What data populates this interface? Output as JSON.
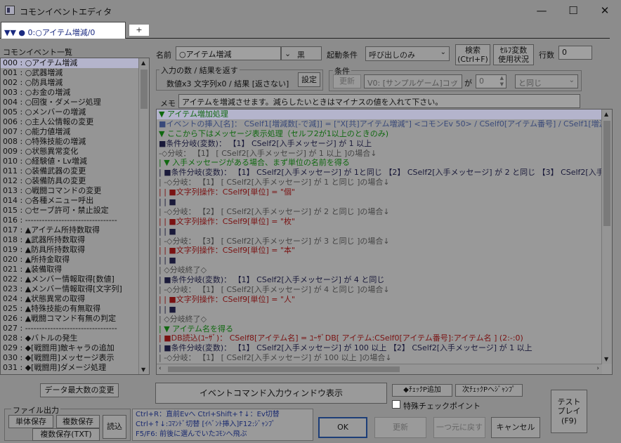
{
  "window": {
    "title": "コモンイベントエディタ",
    "minimize": "—",
    "maximize": "☐",
    "close": "✕"
  },
  "tab": {
    "label": "▼▼ ● 0:○アイテム増減/0",
    "add": "+"
  },
  "list": {
    "header": "コモンイベント一覧",
    "items": [
      "000 : ○アイテム増減",
      "001 : ○武器増減",
      "002 : ○防具増減",
      "003 : ○お金の増減",
      "004 : ○回復・ダメージ処理",
      "005 : ○メンバーの増減",
      "006 : ○主人公情報の変更",
      "007 : ○能力値増減",
      "008 : ○特殊技能の増減",
      "009 : ○状態異常変化",
      "010 : ○経験値・Lv増減",
      "011 : ○装備武器の変更",
      "012 : ○装備防具の変更",
      "013 : ○戦闘コマンドの変更",
      "014 : ○各種メニュー呼出",
      "015 : ○セーブ許可・禁止設定",
      "016 : ---------------------------------",
      "017 : ▲アイテム所持数取得",
      "018 : ▲武器所持数取得",
      "019 : ▲防具所持数取得",
      "020 : ▲所持金取得",
      "021 : ▲装備取得",
      "022 : ▲メンバー情報取得[数値]",
      "023 : ▲メンバー情報取得[文字列]",
      "024 : ▲状態異常の取得",
      "025 : ▲特殊技能の有無取得",
      "026 : ▲戦闘コマンド有無の判定",
      "027 : ---------------------------------",
      "028 : ◆バトルの発生",
      "029 : ◆[戦闘用]敵キャラの追加",
      "030 : ◆[戦闘用]メッセージ表示",
      "031 : ◆[戦闘用]ダメージ処理"
    ]
  },
  "buttons_left": {
    "data_max": "データ最大数の変更",
    "file_output": "ファイル出力",
    "single_save": "単体保存",
    "multi_save": "複数保存",
    "load": "読込",
    "multi_save_txt": "複数保存(TXT)"
  },
  "form": {
    "name_label": "名前",
    "name_value": "○アイテム増減",
    "color_value": "黒",
    "trigger_label": "起動条件",
    "trigger_value": "呼び出しのみ",
    "search_btn": "検索\n(Ctrl+F)",
    "self_var_btn": "ｾﾙﾌ変数\n使用状況",
    "lines_label": "行数",
    "lines_value": "0",
    "io_group": "入力の数 / 結果を返す",
    "io_text": "数値x3 文字列x0 / 結果 [返さない]",
    "io_btn": "設定",
    "cond_group": "条件",
    "cond_update": "更新",
    "cond_var": "V0: [サンプルゲーム]コッ",
    "cond_ga": "が",
    "cond_num": "0",
    "cond_op": "と同じ",
    "memo_label": "メモ",
    "memo_value": "アイテムを増減させます。減らしたいときはマイナスの値を入れて下さい。"
  },
  "commands": [
    {
      "t": "▼ アイテム増加処理",
      "c": "c-green",
      "sel": true
    },
    {
      "t": "■イベントの挿入[名]： CSelf1[増減数[-で減]] = [\"X[共]アイテム増減\"] <コモンEv 50>  / CSelf0[アイテム番号] / CSelf1[増減数[-",
      "c": "c-grayblue"
    },
    {
      "t": "▼ ここから下はメッセージ表示処理（セルフ2が1以上のときのみ)",
      "c": "c-green"
    },
    {
      "t": "■条件分岐(変数)： 【1】 CSelf2[入手メッセージ]  が   1 以上",
      "c": "c-dk"
    },
    {
      "t": "-◇分岐： 【1】 [ CSelf2[入手メッセージ]  が  1 以上  ]の場合↓",
      "c": "c-gray"
    },
    {
      "t": "| ▼ 入手メッセージがある場合、まず単位の名前を得る",
      "c": "c-green"
    },
    {
      "t": "| ■条件分岐(変数)： 【1】 CSelf2[入手メッセージ]  が   1と同じ 【2】 CSelf2[入手メッセージ]  が   2 と同じ 【3】 CSelf2[入手メッセー",
      "c": "c-dk"
    },
    {
      "t": "| -◇分岐： 【1】 [ CSelf2[入手メッセージ]  が  1 と同じ  ]の場合↓",
      "c": "c-gray"
    },
    {
      "t": "| | ■文字列操作：CSelf9[単位] = \"個\"",
      "c": "c-red"
    },
    {
      "t": "| | ■",
      "c": "c-dk"
    },
    {
      "t": "| -◇分岐： 【2】 [ CSelf2[入手メッセージ]  が  2 と同じ  ]の場合↓",
      "c": "c-gray"
    },
    {
      "t": "| | ■文字列操作：CSelf9[単位] = \"枚\"",
      "c": "c-red"
    },
    {
      "t": "| | ■",
      "c": "c-dk"
    },
    {
      "t": "| -◇分岐： 【3】 [ CSelf2[入手メッセージ]  が  3 と同じ  ]の場合↓",
      "c": "c-gray"
    },
    {
      "t": "| | ■文字列操作：CSelf9[単位] = \"本\"",
      "c": "c-red"
    },
    {
      "t": "| | ■",
      "c": "c-dk"
    },
    {
      "t": "| ◇分岐終了◇",
      "c": "c-gray"
    },
    {
      "t": "| ■条件分岐(変数)： 【1】 CSelf2[入手メッセージ]  が   4 と同じ",
      "c": "c-dk"
    },
    {
      "t": "| -◇分岐： 【1】 [ CSelf2[入手メッセージ]  が  4 と同じ  ]の場合↓",
      "c": "c-gray"
    },
    {
      "t": "| | ■文字列操作：CSelf9[単位] = \"人\"",
      "c": "c-red"
    },
    {
      "t": "| | ■",
      "c": "c-dk"
    },
    {
      "t": "| ◇分岐終了◇",
      "c": "c-gray"
    },
    {
      "t": "| ▼ アイテム名を得る",
      "c": "c-green"
    },
    {
      "t": "| ■DB読込(ﾕｰｻﾞ)： CSelf8[アイテム名] = ﾕｰｻﾞDB[ アイテム:CSelf0[アイテム番号]:アイテム名 ] (2:-:0)",
      "c": "c-red"
    },
    {
      "t": "| ■条件分岐(変数)： 【1】 CSelf2[入手メッセージ]  が   100 以上 【2】 CSelf2[入手メッセージ]  が   1 以上",
      "c": "c-dk"
    },
    {
      "t": "| -◇分岐： 【1】 [ CSelf2[入手メッセージ]  が  100 以上  ]の場合↓",
      "c": "c-gray"
    }
  ],
  "bottom": {
    "cmd_input_window": "イベントコマンド入力ウィンドウ表示",
    "check_add": "◆ﾁｪｯｸP追加",
    "next_check": "次ﾁｪｯｸPへｼﾞｬﾝﾌﾟ",
    "special_check": "特殊チェックポイント",
    "test_play": "テスト\nプレイ\n(F9)",
    "help_lines": [
      "Ctrl+R：直前Evへ  Ctrl+Shift+↑↓：Ev切替",
      "Ctrl+↑↓:ｺﾏﾝﾄﾞ切替 [ｲﾍﾞﾝﾄ挿入]F12:ｼﾞｬﾝﾌﾟ",
      "F5/F6: 前後に選んでいたｺﾓﾝへ飛ぶ"
    ],
    "ok": "OK",
    "update": "更新",
    "undo": "一つ元に戻す",
    "cancel": "キャンセル"
  }
}
